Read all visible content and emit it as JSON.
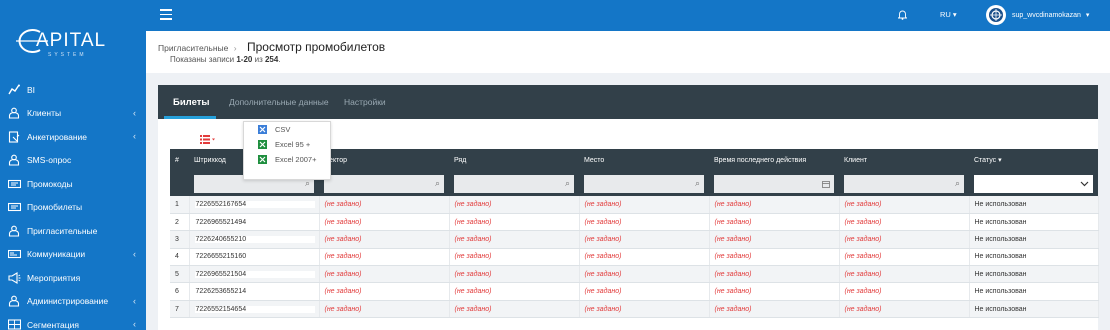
{
  "brand": {
    "logo_main": "APITAL",
    "logo_sub": "SYSTEM"
  },
  "topbar": {
    "lang": "RU ▾",
    "username": "sup_wvcdinamokazan",
    "caret": "▾"
  },
  "sidebar": {
    "items": [
      {
        "label": "BI",
        "icon": "bi-chart-icon",
        "has_chevron": false
      },
      {
        "label": "Клиенты",
        "icon": "users-icon",
        "has_chevron": true
      },
      {
        "label": "Анкетирование",
        "icon": "survey-icon",
        "has_chevron": true
      },
      {
        "label": "SMS-опрос",
        "icon": "sms-icon",
        "has_chevron": false
      },
      {
        "label": "Промокоды",
        "icon": "ticket-icon",
        "has_chevron": false
      },
      {
        "label": "Промобилеты",
        "icon": "ticket-icon",
        "has_chevron": false
      },
      {
        "label": "Пригласительные",
        "icon": "users-icon",
        "has_chevron": false
      },
      {
        "label": "Коммуникации",
        "icon": "communication-icon",
        "has_chevron": true
      },
      {
        "label": "Мероприятия",
        "icon": "megaphone-icon",
        "has_chevron": false
      },
      {
        "label": "Администрирование",
        "icon": "users-icon",
        "has_chevron": true
      },
      {
        "label": "Сегментация",
        "icon": "segmentation-icon",
        "has_chevron": true
      }
    ],
    "chevron": "‹"
  },
  "page": {
    "breadcrumb": "Пригласительные",
    "breadcrumb_sep": "›",
    "title": "Просмотр промобилетов",
    "summary_prefix": "Показаны записи ",
    "summary_range": "1-20",
    "summary_mid": " из ",
    "summary_total": "254",
    "summary_end": "."
  },
  "tabs": [
    "Билеты",
    "Дополнительные данные",
    "Настройки"
  ],
  "export_menu": [
    "CSV",
    "Excel 95 +",
    "Excel 2007+"
  ],
  "table": {
    "columns": [
      "#",
      "Штрихкод",
      "Сектор",
      "Ряд",
      "Место",
      "Время последнего действия",
      "Клиент",
      "Статус ▾"
    ],
    "not_set": "(не задано)",
    "rows": [
      {
        "n": "1",
        "code": "7226552167654",
        "status": "Не использован"
      },
      {
        "n": "2",
        "code": "7226965521494",
        "status": "Не использован"
      },
      {
        "n": "3",
        "code": "7226240655210",
        "status": "Не использован"
      },
      {
        "n": "4",
        "code": "7226655215160",
        "status": "Не использован"
      },
      {
        "n": "5",
        "code": "7226965521504",
        "status": "Не использован"
      },
      {
        "n": "6",
        "code": "7226253655214",
        "status": "Не использован"
      },
      {
        "n": "7",
        "code": "7226552154654",
        "status": "Не использован"
      }
    ]
  },
  "colors": {
    "sidebar": "#1476c7",
    "header_dark": "#324049",
    "accent": "#26a0da",
    "danger": "#e23b3b",
    "excel_green": "#1f8f3f"
  }
}
